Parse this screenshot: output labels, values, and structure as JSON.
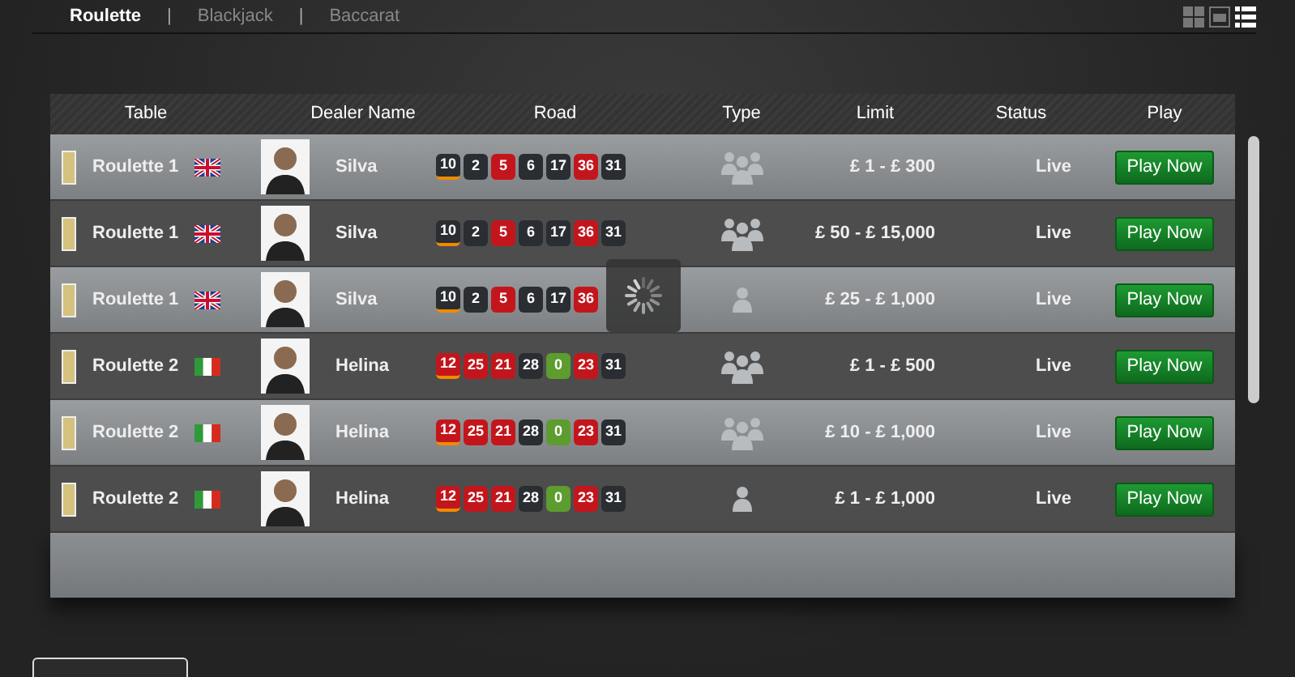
{
  "tabs": [
    {
      "label": "Roulette",
      "selected": true
    },
    {
      "label": "Blackjack",
      "selected": false
    },
    {
      "label": "Baccarat",
      "selected": false
    }
  ],
  "separators": [
    "|",
    "|"
  ],
  "view_options": [
    {
      "kind": "grid",
      "selected": false
    },
    {
      "kind": "card",
      "selected": false
    },
    {
      "kind": "list",
      "selected": true
    }
  ],
  "table": {
    "columns": [
      "Table",
      "Dealer Name",
      "Road",
      "Type",
      "Limit",
      "Status",
      "Play"
    ],
    "rows": [
      {
        "table": "Roulette 1",
        "flag": {
          "kind": "uk"
        },
        "dealer": "Silva",
        "road": [
          {
            "number": "10",
            "color": "#2a2d31",
            "latest": true
          },
          {
            "number": "2",
            "color": "#2a2d31",
            "latest": false
          },
          {
            "number": "5",
            "color": "#c3161c",
            "latest": false
          },
          {
            "number": "6",
            "color": "#2a2d31",
            "latest": false
          },
          {
            "number": "17",
            "color": "#2a2d31",
            "latest": false
          },
          {
            "number": "36",
            "color": "#c3161c",
            "latest": false
          },
          {
            "number": "31",
            "color": "#2a2d31",
            "latest": false
          }
        ],
        "type": {
          "kind": "group"
        },
        "limit": "£ 1 - £ 300",
        "status": "Live",
        "play": "Play Now"
      },
      {
        "table": "Roulette 1",
        "flag": {
          "kind": "uk"
        },
        "dealer": "Silva",
        "road": [
          {
            "number": "10",
            "color": "#2a2d31",
            "latest": true
          },
          {
            "number": "2",
            "color": "#2a2d31",
            "latest": false
          },
          {
            "number": "5",
            "color": "#c3161c",
            "latest": false
          },
          {
            "number": "6",
            "color": "#2a2d31",
            "latest": false
          },
          {
            "number": "17",
            "color": "#2a2d31",
            "latest": false
          },
          {
            "number": "36",
            "color": "#c3161c",
            "latest": false
          },
          {
            "number": "31",
            "color": "#2a2d31",
            "latest": false
          }
        ],
        "type": {
          "kind": "group"
        },
        "limit": "£ 50 - £ 15,000",
        "status": "Live",
        "play": "Play Now"
      },
      {
        "table": "Roulette 1",
        "flag": {
          "kind": "uk"
        },
        "dealer": "Silva",
        "road": [
          {
            "number": "10",
            "color": "#2a2d31",
            "latest": true
          },
          {
            "number": "2",
            "color": "#2a2d31",
            "latest": false
          },
          {
            "number": "5",
            "color": "#c3161c",
            "latest": false
          },
          {
            "number": "6",
            "color": "#2a2d31",
            "latest": false
          },
          {
            "number": "17",
            "color": "#2a2d31",
            "latest": false
          },
          {
            "number": "36",
            "color": "#c3161c",
            "latest": false
          }
        ],
        "type": {
          "kind": "single"
        },
        "limit": "£ 25 - £ 1,000",
        "status": "Live",
        "play": "Play Now"
      },
      {
        "table": "Roulette 2",
        "flag": {
          "kind": "italy"
        },
        "dealer": "Helina",
        "road": [
          {
            "number": "12",
            "color": "#c3161c",
            "latest": true
          },
          {
            "number": "25",
            "color": "#c3161c",
            "latest": false
          },
          {
            "number": "21",
            "color": "#c3161c",
            "latest": false
          },
          {
            "number": "28",
            "color": "#2a2d31",
            "latest": false
          },
          {
            "number": "0",
            "color": "#5d9c2e",
            "latest": false
          },
          {
            "number": "23",
            "color": "#c3161c",
            "latest": false
          },
          {
            "number": "31",
            "color": "#2a2d31",
            "latest": false
          }
        ],
        "type": {
          "kind": "group"
        },
        "limit": "£ 1 - £ 500",
        "status": "Live",
        "play": "Play Now"
      },
      {
        "table": "Roulette 2",
        "flag": {
          "kind": "italy"
        },
        "dealer": "Helina",
        "road": [
          {
            "number": "12",
            "color": "#c3161c",
            "latest": true
          },
          {
            "number": "25",
            "color": "#c3161c",
            "latest": false
          },
          {
            "number": "21",
            "color": "#c3161c",
            "latest": false
          },
          {
            "number": "28",
            "color": "#2a2d31",
            "latest": false
          },
          {
            "number": "0",
            "color": "#5d9c2e",
            "latest": false
          },
          {
            "number": "23",
            "color": "#c3161c",
            "latest": false
          },
          {
            "number": "31",
            "color": "#2a2d31",
            "latest": false
          }
        ],
        "type": {
          "kind": "group"
        },
        "limit": "£ 10 - £ 1,000",
        "status": "Live",
        "play": "Play Now"
      },
      {
        "table": "Roulette 2",
        "flag": {
          "kind": "italy"
        },
        "dealer": "Helina",
        "road": [
          {
            "number": "12",
            "color": "#c3161c",
            "latest": true
          },
          {
            "number": "25",
            "color": "#c3161c",
            "latest": false
          },
          {
            "number": "21",
            "color": "#c3161c",
            "latest": false
          },
          {
            "number": "28",
            "color": "#2a2d31",
            "latest": false
          },
          {
            "number": "0",
            "color": "#5d9c2e",
            "latest": false
          },
          {
            "number": "23",
            "color": "#c3161c",
            "latest": false
          },
          {
            "number": "31",
            "color": "#2a2d31",
            "latest": false
          }
        ],
        "type": {
          "kind": "single"
        },
        "limit": "£ 1 - £ 1,000",
        "status": "Live",
        "play": "Play Now"
      }
    ]
  },
  "loading": true
}
